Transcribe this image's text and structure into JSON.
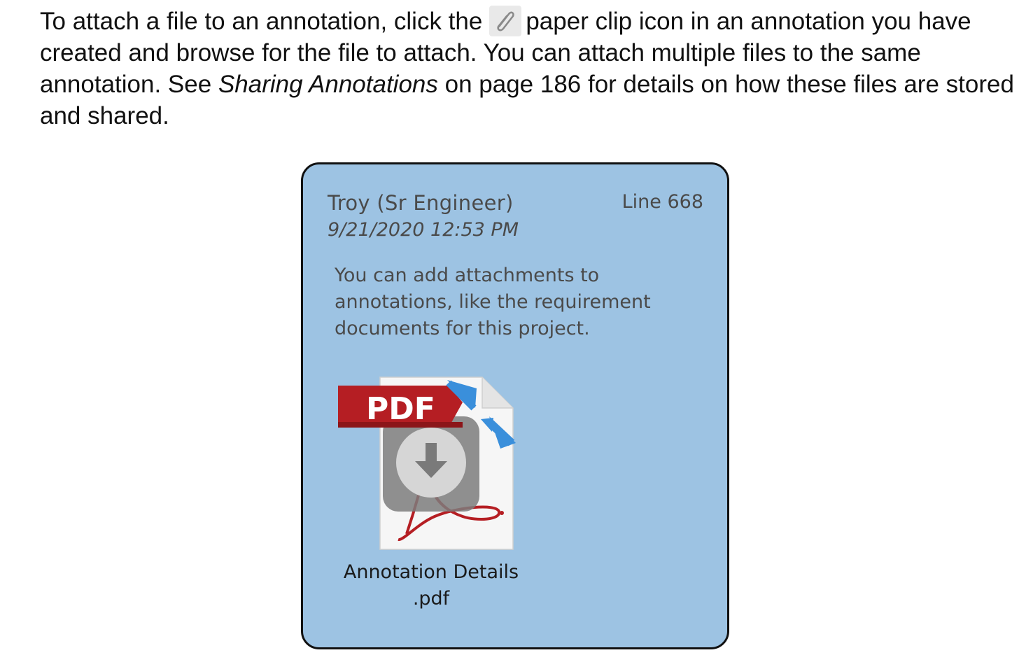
{
  "paragraph": {
    "part1": "To attach a file to an annotation, click the",
    "part2": "paper clip icon in an annotation you have created and browse for the file to attach. You can attach multiple files to the same annotation. See",
    "link_italic": "Sharing Annotations",
    "part3": "on page 186 for details on how these files are stored and shared.",
    "icon": "paperclip-icon"
  },
  "annotation": {
    "author": "Troy (Sr Engineer)",
    "line": "Line 668",
    "timestamp": "9/21/2020 12:53 PM",
    "body": "You can add attachments to annotations, like the requirement documents for this project.",
    "background_color": "#9dc3e3",
    "attachment": {
      "icon": "pdf-file-icon",
      "badge_text": "PDF",
      "filename_line1": "Annotation Details",
      "filename_line2": ".pdf"
    }
  }
}
